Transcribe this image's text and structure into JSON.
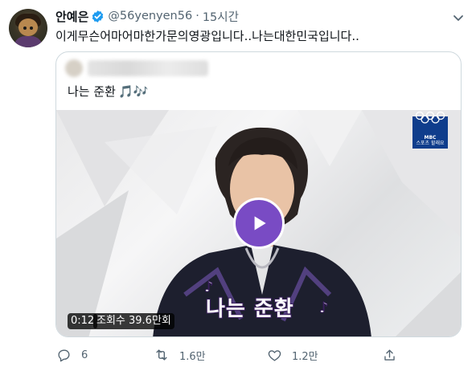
{
  "tweet": {
    "display_name": "안예은",
    "handle": "@56yenyen56",
    "separator": "·",
    "time": "15시간",
    "text": "이게무슨어마어마한가문의영광입니다..나는대한민국입니다.."
  },
  "quoted": {
    "text": "나는 준환",
    "emoji": "🎵🎶",
    "video": {
      "caption": "나는 준환",
      "duration": "0:12",
      "views": "조회수 39.6만회",
      "broadcaster_line1": "MBC",
      "broadcaster_line2": "스포츠 할래요"
    }
  },
  "actions": {
    "reply_count": "6",
    "retweet_count": "1.6만",
    "like_count": "1.2만"
  },
  "colors": {
    "accent": "#1d9bf0",
    "play_button": "#794bc4",
    "text_primary": "#0f1419",
    "text_secondary": "#536471",
    "border": "#cfd9de"
  },
  "icons": [
    "verified-badge-icon",
    "more-caret-icon",
    "play-icon",
    "olympic-rings-icon",
    "reply-icon",
    "retweet-icon",
    "like-icon",
    "share-icon"
  ]
}
